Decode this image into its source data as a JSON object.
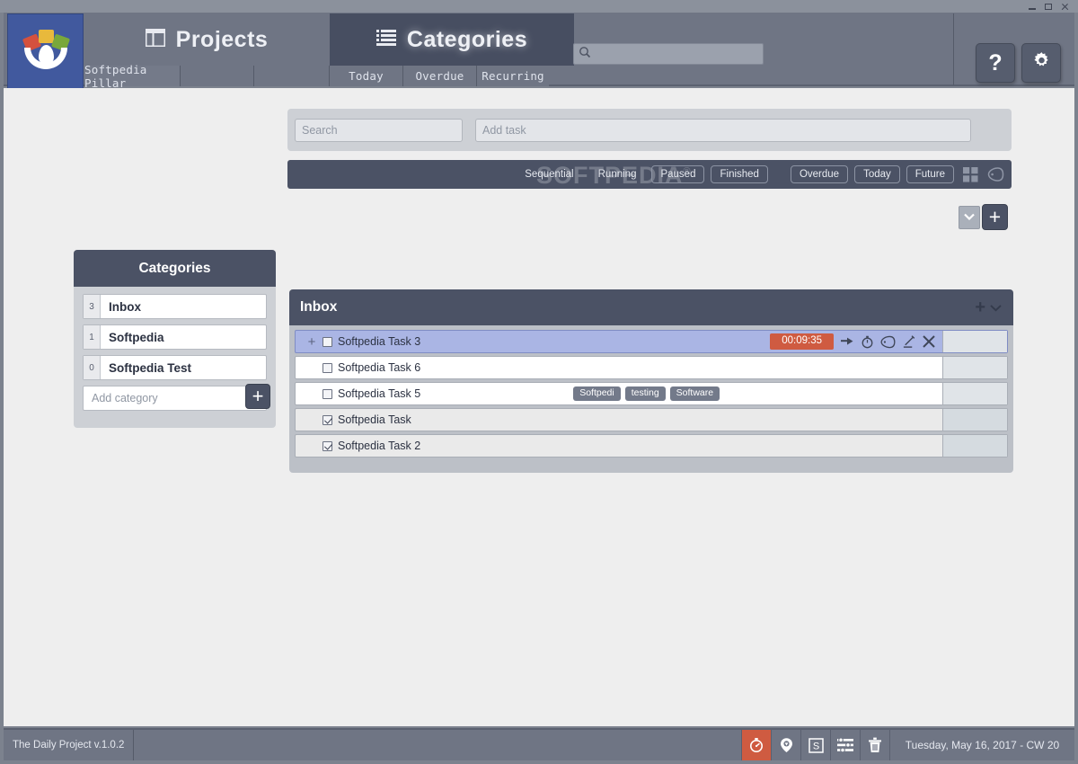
{
  "window": {
    "minimize": "minimize-button",
    "maximize": "maximize-button",
    "close": "close-button"
  },
  "header": {
    "tabs": [
      {
        "label": "Projects",
        "icon": "columns-icon",
        "active": false
      },
      {
        "label": "Categories",
        "icon": "list-icon",
        "active": true
      }
    ],
    "subtabs": [
      {
        "label": "Softpedia Pillar",
        "active": true
      },
      {
        "label": "",
        "active": false
      },
      {
        "label": "",
        "active": false
      },
      {
        "label": "Today",
        "active": false
      },
      {
        "label": "Overdue",
        "active": false
      },
      {
        "label": "Recurring",
        "active": false
      }
    ],
    "search": {
      "value": "",
      "placeholder": "",
      "icon": "search-icon"
    },
    "help_label": "?",
    "gear_icon": "gear-icon"
  },
  "inputbar": {
    "search": {
      "value": "",
      "placeholder": "Search"
    },
    "addtask": {
      "value": "",
      "placeholder": "Add task"
    },
    "dropdown_icon": "chevron-down-icon",
    "add_label": "+"
  },
  "filterbar": {
    "watermark": "SOFTPEDIA",
    "watermark_reg": "®",
    "buttons": [
      {
        "label": "Sequential",
        "style": "flat"
      },
      {
        "label": "Running",
        "style": "flat"
      },
      {
        "label": "Paused",
        "style": "outlined"
      },
      {
        "label": "Finished",
        "style": "outlined"
      },
      {
        "label": "Overdue",
        "style": "outlined"
      },
      {
        "label": "Today",
        "style": "outlined"
      },
      {
        "label": "Future",
        "style": "outlined"
      }
    ],
    "grid_icon": "grid-view-icon",
    "tag_icon": "tag-icon"
  },
  "categories": {
    "title": "Categories",
    "items": [
      {
        "count": "3",
        "name": "Inbox"
      },
      {
        "count": "1",
        "name": "Softpedia"
      },
      {
        "count": "0",
        "name": "Softpedia Test"
      }
    ],
    "add": {
      "value": "",
      "placeholder": "Add category",
      "button_label": "+"
    }
  },
  "tasks": {
    "panel_title": "Inbox",
    "head_add_label": "+",
    "head_chevron_icon": "chevron-down-icon",
    "rows": [
      {
        "title": "Softpedia Task 3",
        "checked": false,
        "state": "selected",
        "drag_handle": "+",
        "timer": "00:09:35",
        "tags": [],
        "actions": [
          "move-task-icon",
          "timer-icon",
          "tag-icon",
          "edit-icon",
          "delete-icon"
        ]
      },
      {
        "title": "Softpedia Task 6",
        "checked": false,
        "state": "plain",
        "timer": "",
        "tags": [],
        "actions": []
      },
      {
        "title": "Softpedia Task 5",
        "checked": false,
        "state": "plain",
        "timer": "",
        "tags": [
          "Softpedi",
          "testing",
          "Software"
        ],
        "actions": []
      },
      {
        "title": "Softpedia Task",
        "checked": true,
        "state": "done",
        "timer": "",
        "tags": [],
        "actions": []
      },
      {
        "title": "Softpedia Task 2",
        "checked": true,
        "state": "done",
        "timer": "",
        "tags": [],
        "actions": []
      }
    ]
  },
  "footer": {
    "version": "The Daily Project v.1.0.2",
    "icons": [
      {
        "name": "stopwatch-icon",
        "active": true
      },
      {
        "name": "location-pin-icon",
        "active": false
      },
      {
        "name": "s-box-icon",
        "active": false
      },
      {
        "name": "settings-sliders-icon",
        "active": false
      },
      {
        "name": "trash-icon",
        "active": false
      }
    ],
    "date": "Tuesday, May 16, 2017 - CW 20"
  }
}
